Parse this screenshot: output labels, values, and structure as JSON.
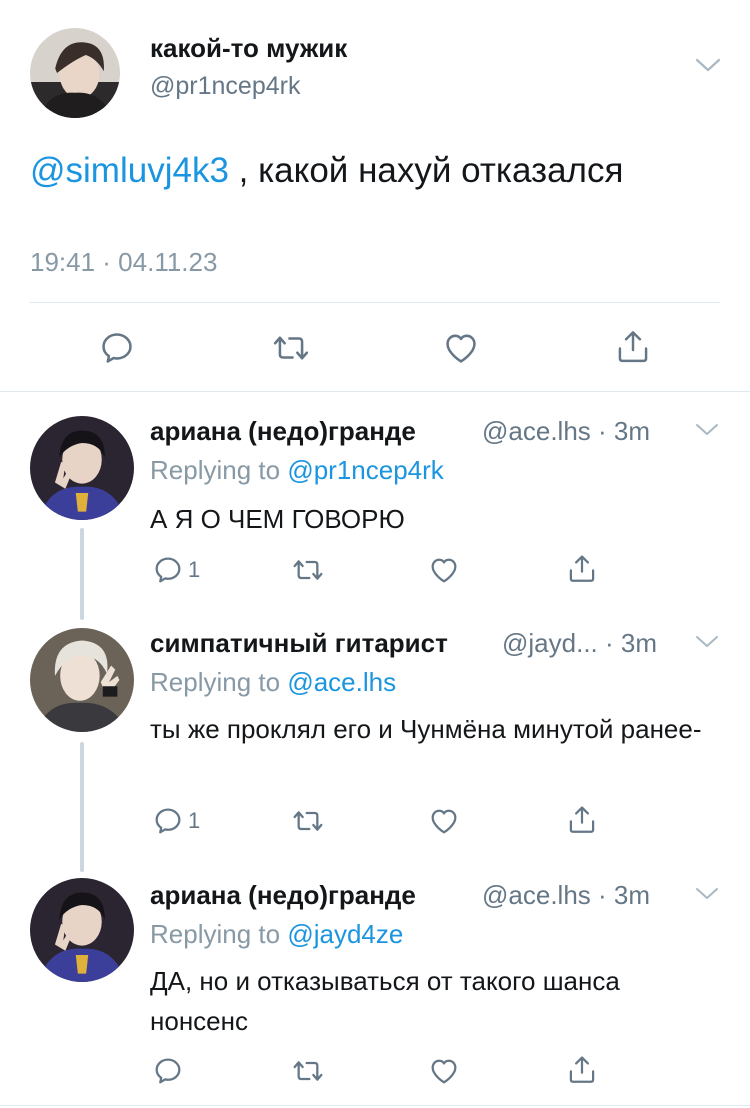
{
  "main_tweet": {
    "author_name": "какой-то мужик",
    "author_handle": "@pr1ncep4rk",
    "mention": "@simluvj4k3",
    "text": " , какой нахуй отказался",
    "timestamp": "19:41 · 04.11.23",
    "icons": [
      "reply-icon",
      "retweet-icon",
      "like-icon",
      "share-icon"
    ]
  },
  "replies": [
    {
      "author_name": "ариана (недо)гранде",
      "author_handle": "@ace.lhs",
      "separator": "·",
      "time": "3m",
      "replying_to_label": "Replying to",
      "replying_to_handle": "@pr1ncep4rk",
      "text": "А Я О ЧЕМ ГОВОРЮ",
      "reply_count": "1"
    },
    {
      "author_name": "симпатичный гитарист",
      "author_handle": "@jayd...",
      "separator": "·",
      "time": "3m",
      "replying_to_label": "Replying to",
      "replying_to_handle": "@ace.lhs",
      "text": "ты же проклял его и Чунмёна минутой ранее-",
      "reply_count": "1"
    },
    {
      "author_name": "ариана (недо)гранде",
      "author_handle": "@ace.lhs",
      "separator": "·",
      "time": "3m",
      "replying_to_label": "Replying to",
      "replying_to_handle": "@jayd4ze",
      "text": "ДА, но и отказываться от такого шанса нонсенс",
      "reply_count": ""
    }
  ],
  "colors": {
    "link": "#1b95e0",
    "icon": "#657786",
    "secondary_text": "#8899a6",
    "divider": "#e1e8ed",
    "thread_line": "#ccd6dd"
  }
}
